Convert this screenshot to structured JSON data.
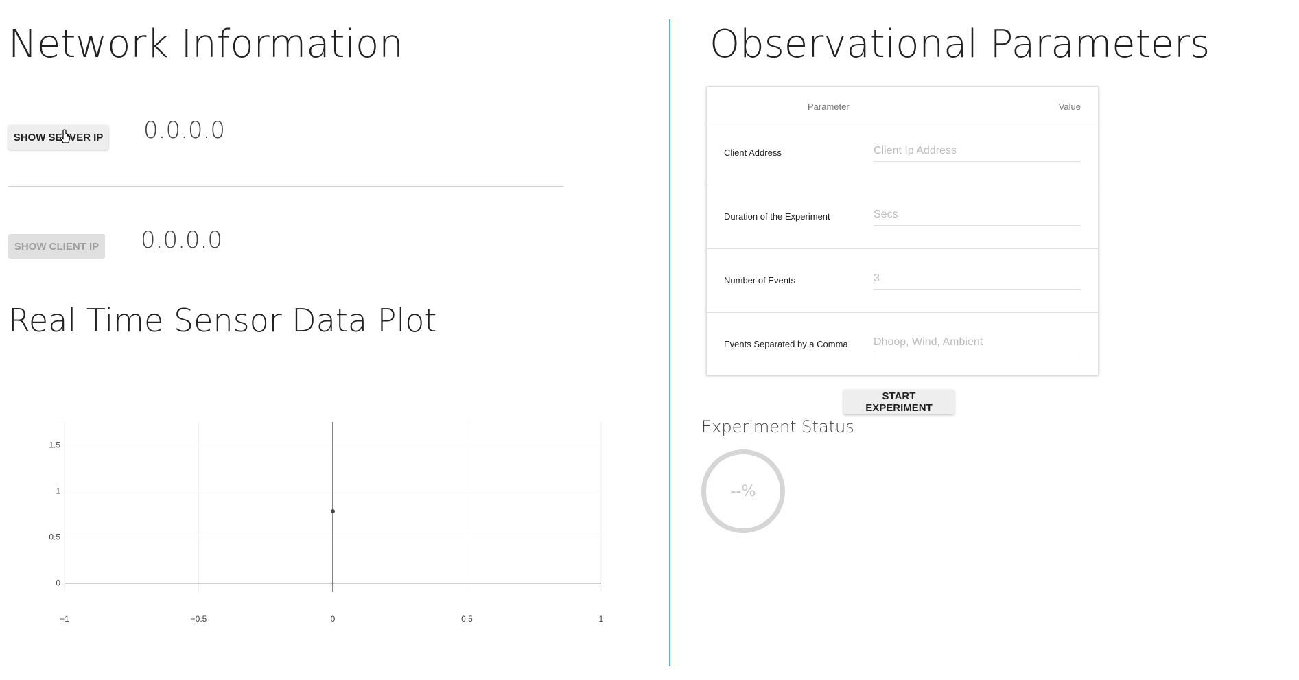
{
  "network": {
    "title": "Network Information",
    "server_button": "SHOW SERVER IP",
    "server_ip": "0.0.0.0",
    "client_button": "SHOW CLIENT IP",
    "client_ip": "0.0.0.0"
  },
  "plot": {
    "title": "Real Time Sensor Data Plot"
  },
  "chart_data": {
    "type": "scatter",
    "title": "",
    "xlabel": "",
    "ylabel": "",
    "x": [
      0
    ],
    "y": [
      0.78
    ],
    "xlim": [
      -1,
      1
    ],
    "ylim": [
      -0.1,
      1.75
    ],
    "x_ticks": [
      -1,
      -0.5,
      0,
      0.5,
      1
    ],
    "x_tick_labels": [
      "−1",
      "−0.5",
      "0",
      "0.5",
      "1"
    ],
    "y_ticks": [
      0,
      0.5,
      1,
      1.5
    ],
    "y_tick_labels": [
      "0",
      "0.5",
      "1",
      "1.5"
    ],
    "grid": true
  },
  "observational": {
    "title": "Observational Parameters",
    "header_parameter": "Parameter",
    "header_value": "Value",
    "rows": [
      {
        "label": "Client Address",
        "placeholder": "Client Ip Address"
      },
      {
        "label": "Duration of the Experiment",
        "placeholder": "Secs"
      },
      {
        "label": "Number of Events",
        "placeholder": "3"
      },
      {
        "label": "Events Separated by a Comma",
        "placeholder": "Dhoop, Wind, Ambient"
      }
    ],
    "start_button": "START EXPERIMENT"
  },
  "status": {
    "title": "Experiment Status",
    "progress_text": "--%"
  },
  "colors": {
    "divider_accent": "#4fb3d9",
    "button_bg": "#eeeeee",
    "disabled_text": "#9e9e9e"
  }
}
